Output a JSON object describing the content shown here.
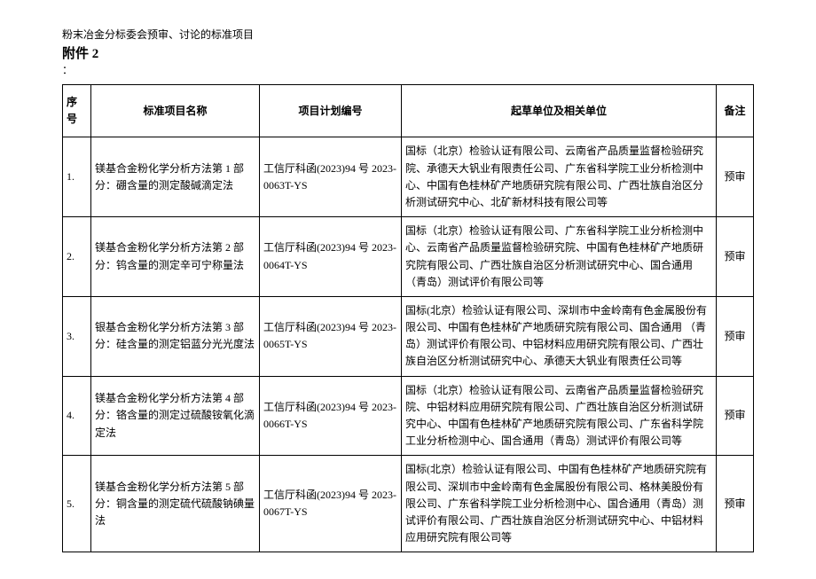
{
  "header": {
    "doc_title": "粉末冶金分标委会预审、讨论的标准项目",
    "attachment_label": "附件 2",
    "colon": "："
  },
  "table": {
    "headers": {
      "seq": "序号",
      "name": "标准项目名称",
      "plan": "项目计划编号",
      "units": "起草单位及相关单位",
      "note": "备注"
    },
    "rows": [
      {
        "seq": "1.",
        "name": "镁基合金粉化学分析方法第 1 部分：硼含量的测定酸碱滴定法",
        "plan": "工信厅科函(2023)94 号 2023-0063T-YS",
        "units": "国标（北京）检验认证有限公司、云南省产品质量监督检验研究院、承德天大钒业有限责任公司、广东省科学院工业分析检测中心、中国有色桂林矿产地质研究院有限公司、广西壮族自治区分析测试研究中心、北矿新材科技有限公司等",
        "note": "预审"
      },
      {
        "seq": "2.",
        "name": "镁基合金粉化学分析方法第 2 部分：钨含量的测定辛可宁称量法",
        "plan": "工信厅科函(2023)94 号 2023-0064T-YS",
        "units": "国标（北京）检验认证有限公司、广东省科学院工业分析检测中心、云南省产品质量监督检验研究院、中国有色桂林矿产地质研究院有限公司、广西壮族自治区分析测试研究中心、国合通用\n（青岛）测试评价有限公司等",
        "note": "预审"
      },
      {
        "seq": "3.",
        "name": "银基合金粉化学分析方法第 3 部分：硅含量的测定铝蓝分光光度法",
        "plan": "工信厅科函(2023)94 号 2023-0065T-YS",
        "units": "国标(北京）检验认证有限公司、深圳市中金岭南有色金属股份有限公司、中国有色桂林矿产地质研究院有限公司、国合通用\n（青岛）测试评价有限公司、中铝材料应用研究院有限公司、广西壮族自治区分析测试研究中心、承德天大钒业有限责任公司等",
        "note": "预审"
      },
      {
        "seq": "4.",
        "name": "镁基合金粉化学分析方法第 4 部分：铬含量的测定过硫酸铵氧化滴定法",
        "plan": "工信厅科函(2023)94 号 2023-0066T-YS",
        "units": "国标（北京）检验认证有限公司、云南省产品质量监督检验研究院、中铝材料应用研究院有限公司、广西壮族自治区分析测试研究中心、中国有色桂林矿产地质研究院有限公司、广东省科学院工业分析检测中心、国合通用（青岛）测试评价有限公司等",
        "note": "预审"
      },
      {
        "seq": "5.",
        "name": "镁基合金粉化学分析方法第 5 部分：铜含量的测定硫代硫酸钠碘量法",
        "plan": "工信厅科函(2023)94 号 2023-0067T-YS",
        "units": "国标(北京）检验认证有限公司、中国有色桂林矿产地质研究院有限公司、深圳市中金岭南有色金属股份有限公司、格林美股份有限公司、广东省科学院工业分析检测中心、国合通用（青岛）测试评价有限公司、广西壮族自治区分析测试研究中心、中铝材料应用研究院有限公司等",
        "note": "预审"
      }
    ]
  }
}
